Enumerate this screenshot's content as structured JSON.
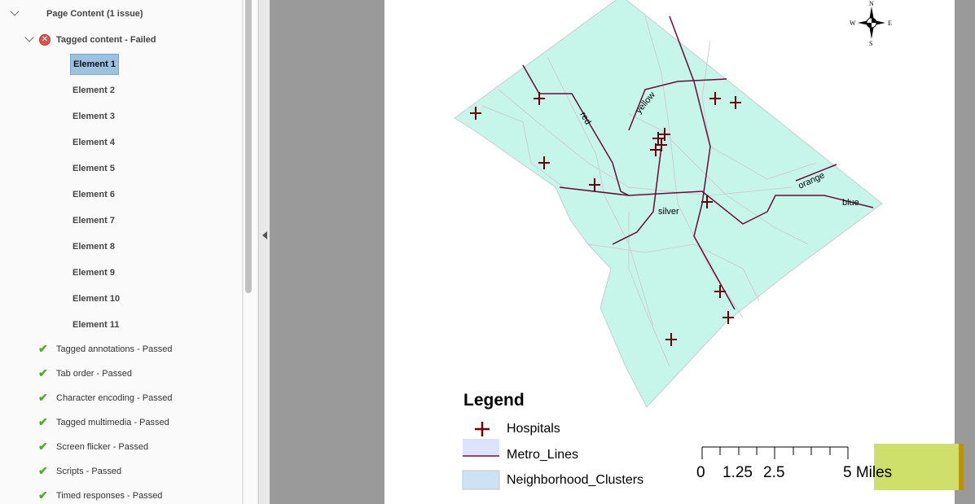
{
  "panel": {
    "group": "Page Content (1 issue)",
    "failed_item": "Tagged content - Failed",
    "elements": [
      "Element 1",
      "Element 2",
      "Element 3",
      "Element 4",
      "Element 5",
      "Element 6",
      "Element 7",
      "Element 8",
      "Element 9",
      "Element 10",
      "Element 11"
    ],
    "selected_element": "Element 1",
    "passed": [
      "Tagged annotations - Passed",
      "Tab order - Passed",
      "Character encoding - Passed",
      "Tagged multimedia - Passed",
      "Screen flicker - Passed",
      "Scripts - Passed",
      "Timed responses - Passed"
    ]
  },
  "map": {
    "compass": {
      "n": "N",
      "s": "S",
      "e": "E",
      "w": "W"
    },
    "line_labels": {
      "red": "red",
      "yellow": "yellow",
      "orange": "orange",
      "blue": "blue",
      "silver": "silver"
    },
    "colors": {
      "fill": "#c6f5ea",
      "lines": "#6b0a3a",
      "hospital": "#6b0000"
    },
    "legend": {
      "title": "Legend",
      "items": [
        "Hospitals",
        "Metro_Lines",
        "Neighborhood_Clusters"
      ]
    },
    "scale": {
      "labels": [
        "0",
        "1.25",
        "2.5",
        "5 Miles"
      ]
    }
  }
}
